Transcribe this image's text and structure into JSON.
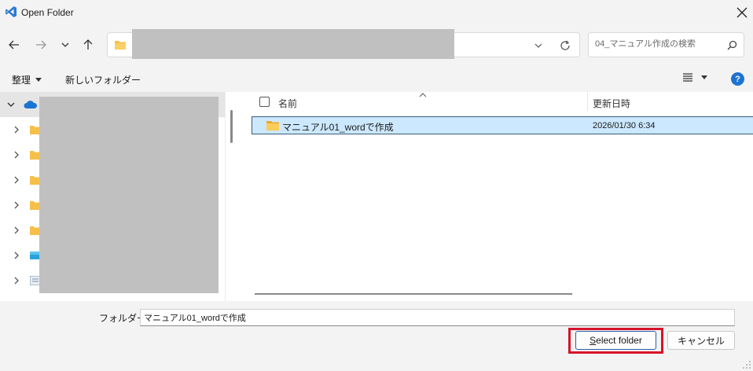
{
  "window": {
    "title": "Open Folder"
  },
  "address": {
    "path": ""
  },
  "search": {
    "placeholder": "04_マニュアル作成の検索"
  },
  "commandbar": {
    "organize_label": "整理",
    "new_folder_label": "新しいフォルダー"
  },
  "help": {
    "label": "?"
  },
  "list": {
    "columns": {
      "name": "名前",
      "date": "更新日時"
    },
    "rows": [
      {
        "name": "マニュアル01_wordで作成",
        "date": "2026/01/30 6:34",
        "selected": true
      }
    ]
  },
  "footer": {
    "folder_label": "フォルダー:",
    "folder_value": "マニュアル01_wordで作成",
    "select_accel": "S",
    "select_rest": "elect folder",
    "cancel_label": "キャンセル"
  },
  "colors": {
    "accent": "#1e73d2",
    "selection": "#cce8ff",
    "folder": "#f5c04a",
    "highlight": "#d6132a",
    "vscode": "#2b7bd1"
  },
  "icons": [
    "vscode-icon",
    "close-icon",
    "back-arrow-icon",
    "forward-arrow-icon",
    "chevron-down-icon",
    "up-arrow-icon",
    "folder-icon",
    "refresh-icon",
    "search-icon",
    "view-details-icon",
    "help-icon",
    "onedrive-icon",
    "chevron-right-icon",
    "sort-up-icon"
  ]
}
